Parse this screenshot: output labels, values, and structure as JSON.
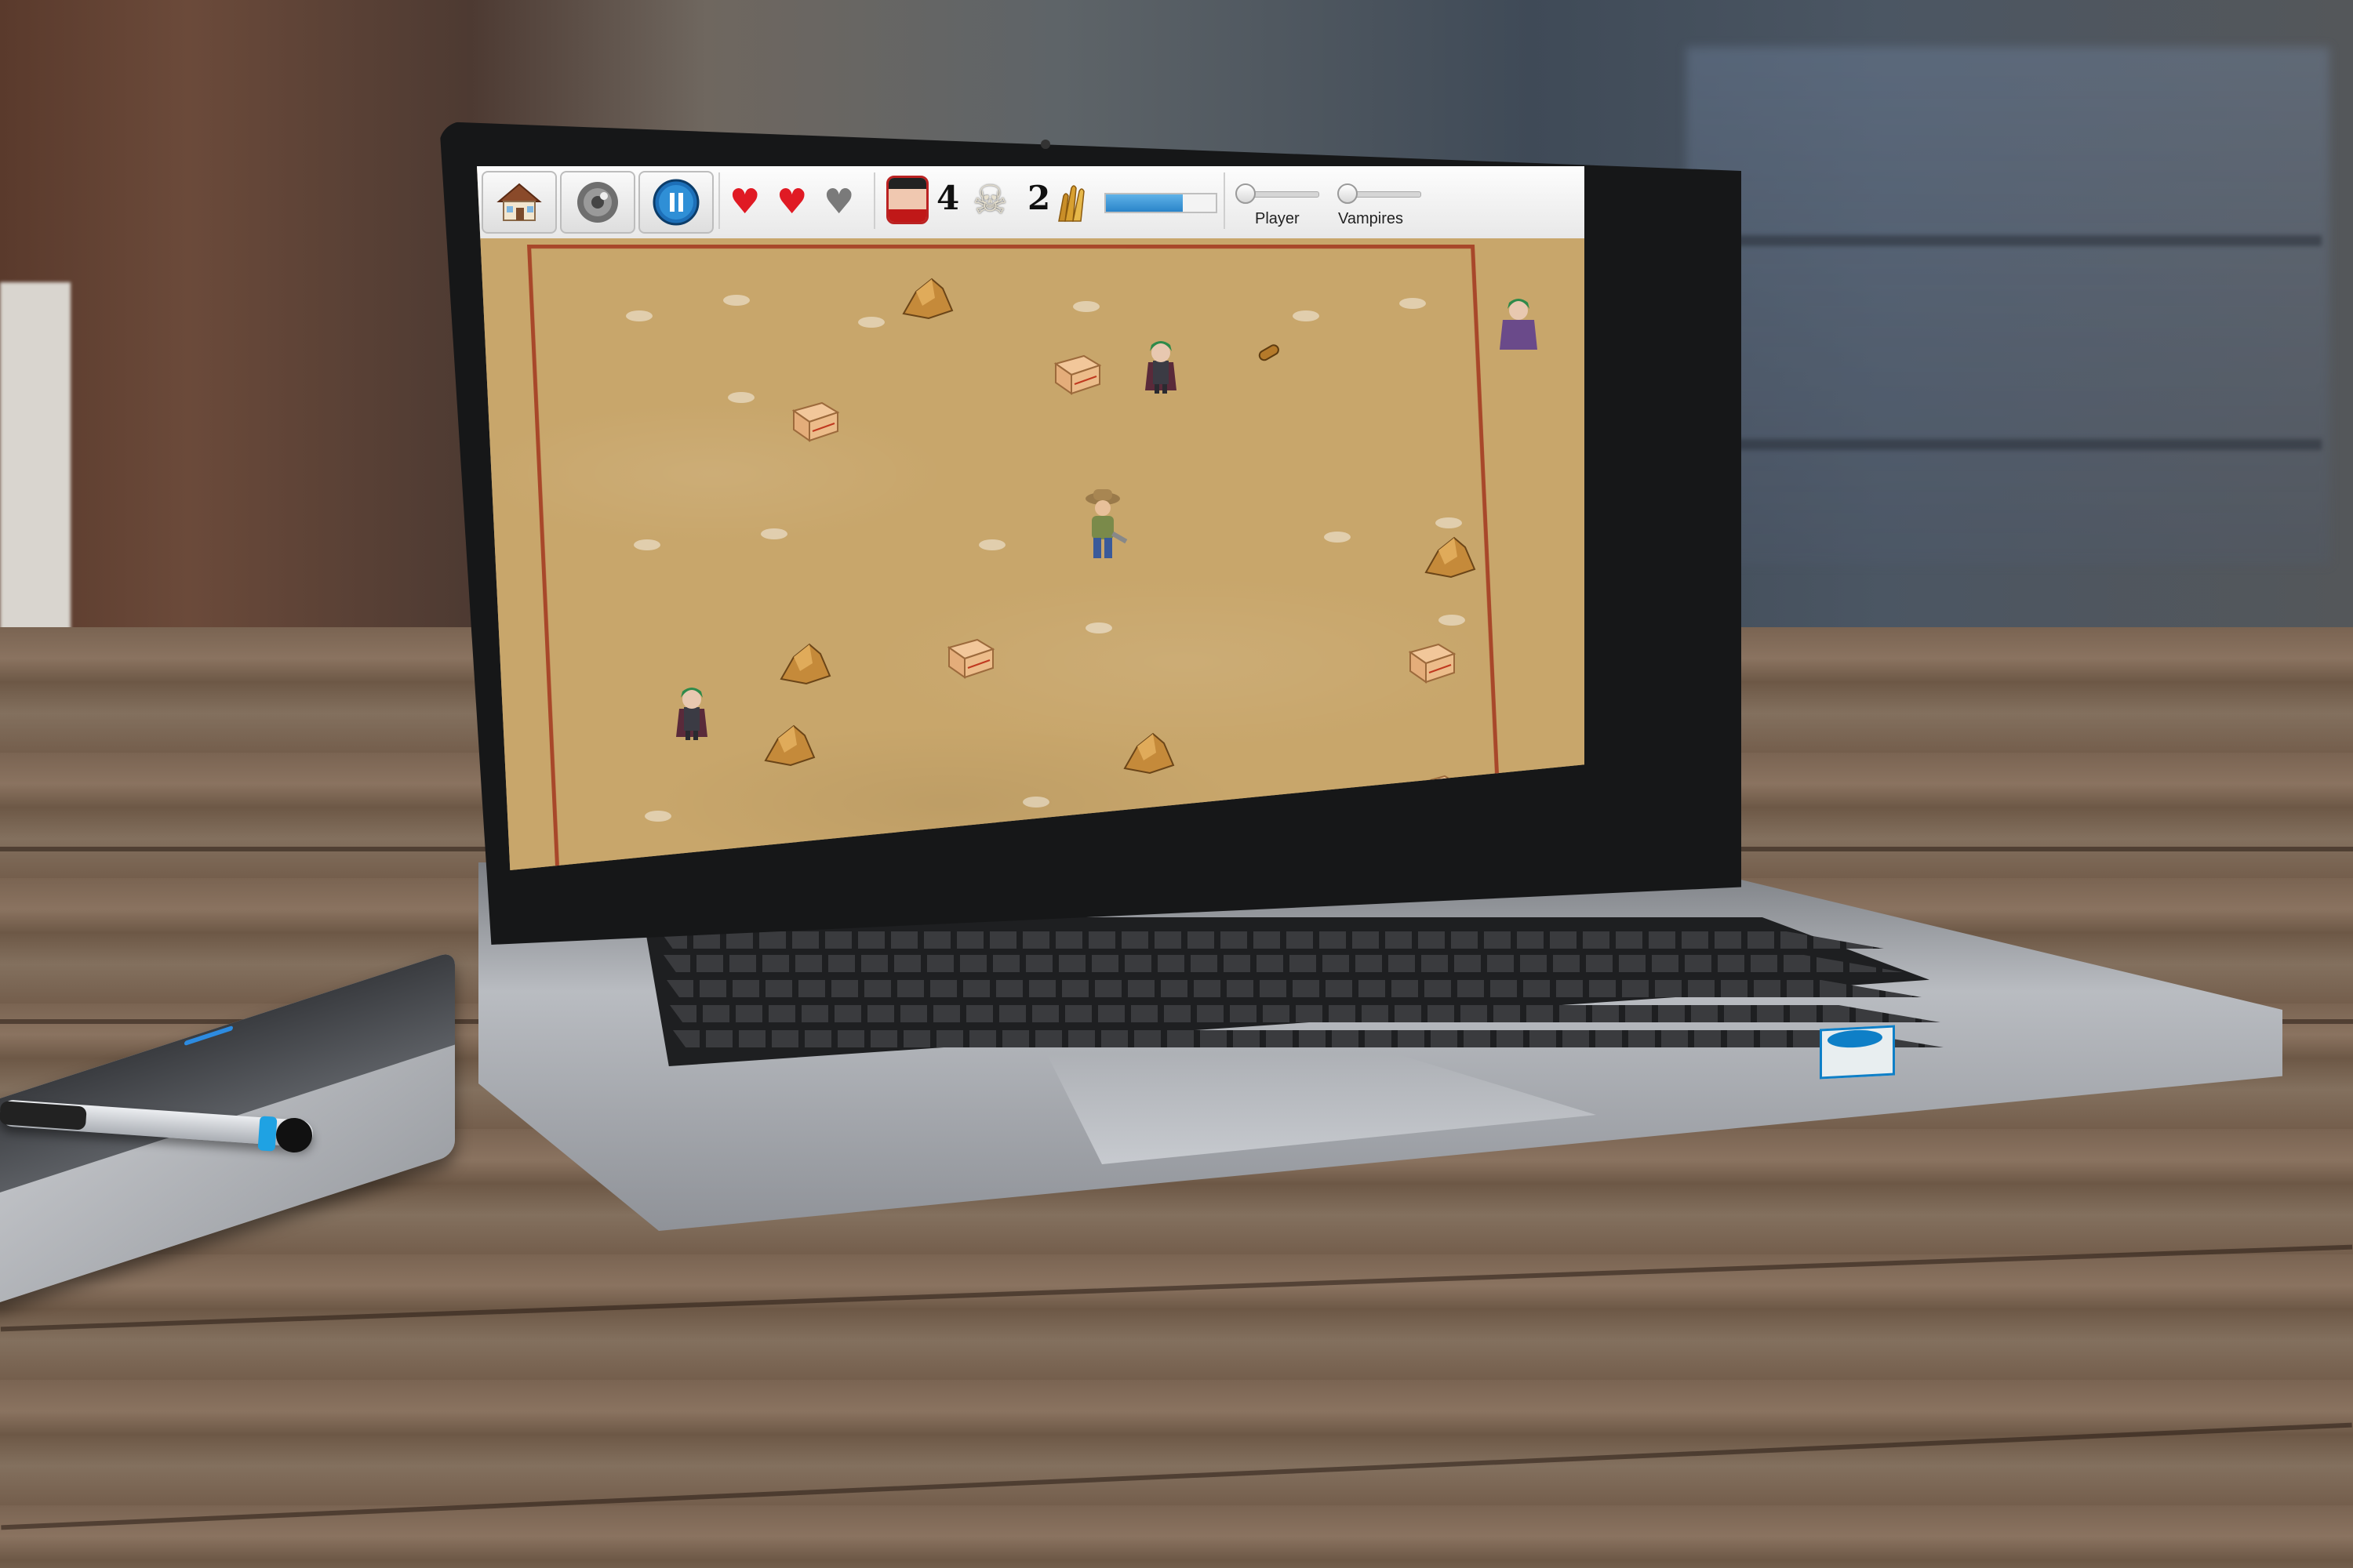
{
  "colors": {
    "accent": "#2a84c9",
    "arena_border": "#a8472a",
    "sand": "#c8a66b",
    "heart_full": "#e01a24",
    "heart_empty": "#7a7a7a"
  },
  "toolbar": {
    "home_icon": "home-icon",
    "sound_icon": "speaker-icon",
    "pause_icon": "pause-icon"
  },
  "hud": {
    "lives": [
      {
        "state": "full"
      },
      {
        "state": "full"
      },
      {
        "state": "empty"
      }
    ],
    "player_count": "4",
    "kills": "2",
    "ammo_icon": "bullets-icon",
    "progress": 0.7
  },
  "sliders": {
    "player": {
      "label": "Player",
      "value": 0.05
    },
    "vampires": {
      "label": "Vampires",
      "value": 0.05
    }
  }
}
